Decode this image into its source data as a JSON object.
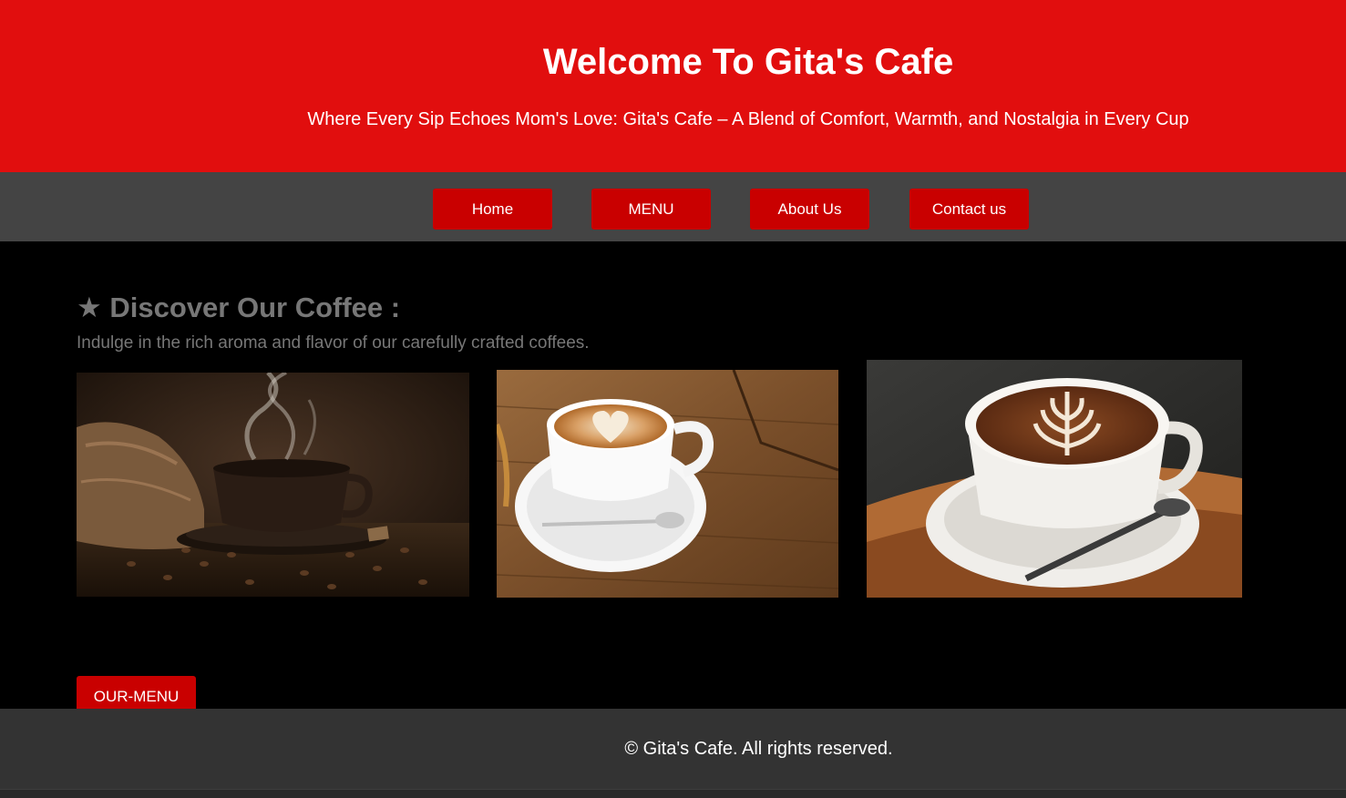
{
  "header": {
    "title": "Welcome To Gita's Cafe",
    "tagline": "Where Every Sip Echoes Mom's Love: Gita's Cafe – A Blend of Comfort, Warmth, and Nostalgia in Every Cup"
  },
  "nav": {
    "items": [
      {
        "label": "Home"
      },
      {
        "label": "MENU"
      },
      {
        "label": "About Us"
      },
      {
        "label": "Contact us"
      }
    ]
  },
  "section": {
    "title": "★ Discover Our Coffee :",
    "subtitle": "Indulge in the rich aroma and flavor of our carefully crafted coffees.",
    "menu_button": "OUR-MENU"
  },
  "footer": {
    "text": "© Gita's Cafe. All rights reserved."
  },
  "colors": {
    "header_red": "#e10e0e",
    "button_red": "#c90000",
    "nav_gray": "#444444",
    "footer_gray": "#333333"
  }
}
